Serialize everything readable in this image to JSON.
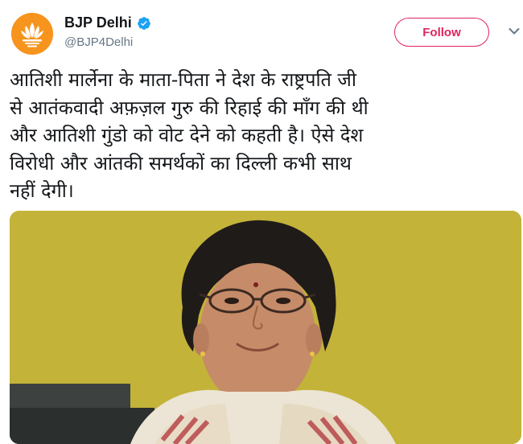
{
  "account": {
    "name": "BJP Delhi",
    "handle": "@BJP4Delhi",
    "verified": true,
    "avatar_icon": "bjp-lotus-logo"
  },
  "actions": {
    "follow_label": "Follow",
    "menu_icon": "chevron-down-icon"
  },
  "tweet": {
    "lines": [
      "आतिशी मार्लेना के माता-पिता ने देश के राष्ट्रपति जी",
      "से आतंकवादी अफ़ज़ल गुरु की रिहाई की माँग की थी",
      "और आतिशी गुंडो को वोट देने को कहती है। ऐसे देश",
      "विरोधी और आंतकी समर्थकों का दिल्ली कभी साथ",
      "नहीं देगी।"
    ]
  },
  "colors": {
    "follow_accent": "#e0245e",
    "verified_blue": "#1da1f2",
    "avatar_orange": "#f7941d",
    "photo_background": "#c8b53a"
  }
}
